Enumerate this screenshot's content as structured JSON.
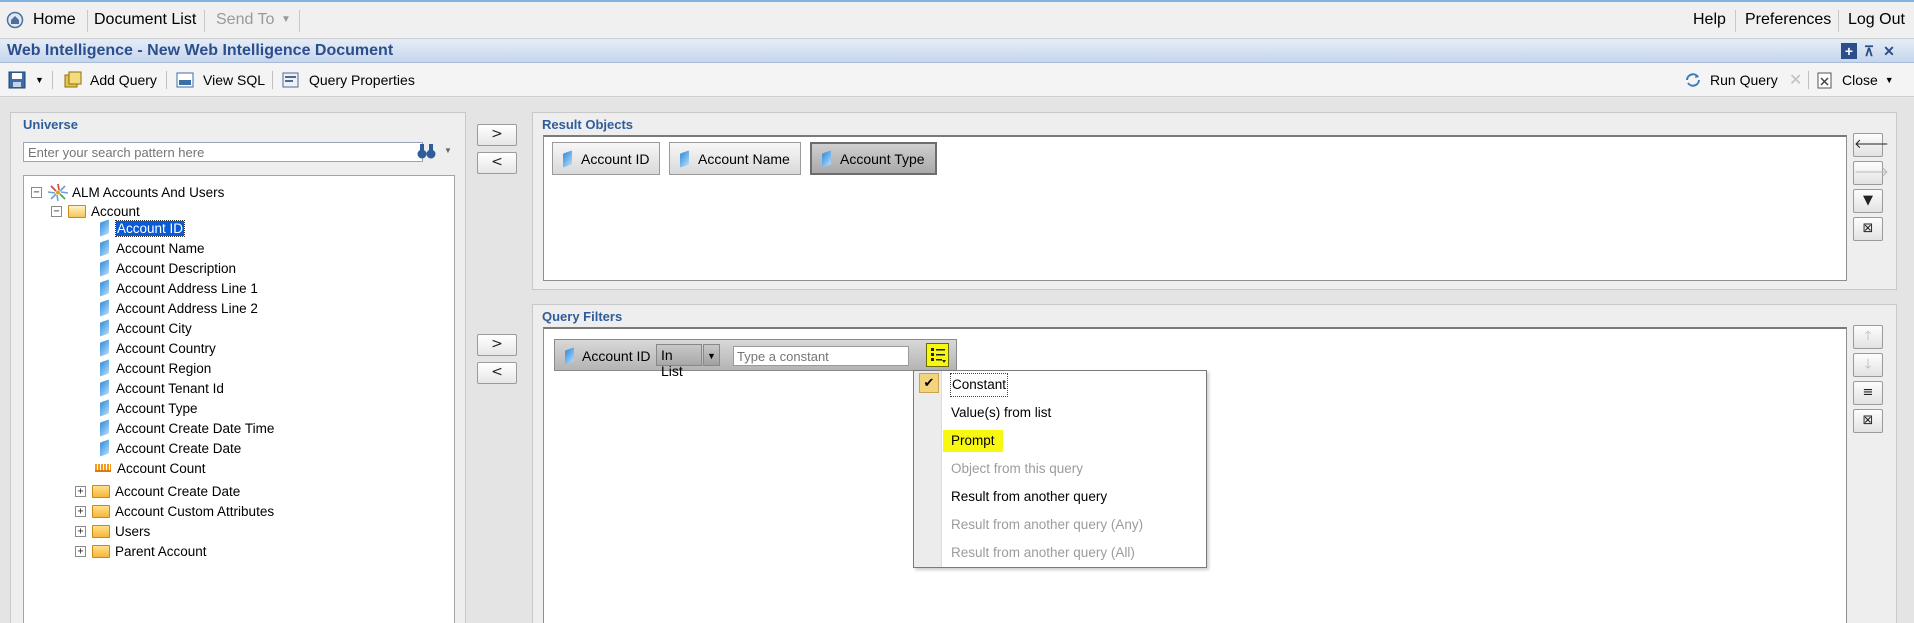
{
  "topnav": {
    "home": "Home",
    "document_list": "Document List",
    "send_to": "Send To",
    "help": "Help",
    "preferences": "Preferences",
    "logout": "Log Out"
  },
  "window": {
    "title": "Web Intelligence - New Web Intelligence Document"
  },
  "toolbar": {
    "add_query": "Add Query",
    "view_sql": "View SQL",
    "query_properties": "Query Properties",
    "run_query": "Run Query",
    "close": "Close"
  },
  "universe": {
    "title": "Universe",
    "search_placeholder": "Enter your search pattern here",
    "root": "ALM Accounts And Users",
    "folder": "Account",
    "objects": [
      "Account ID",
      "Account Name",
      "Account Description",
      "Account Address Line 1",
      "Account Address Line 2",
      "Account City",
      "Account Country",
      "Account Region",
      "Account Tenant Id",
      "Account Type",
      "Account Create Date Time",
      "Account Create Date"
    ],
    "measure": "Account Count",
    "subfolders": [
      "Account Create Date",
      "Account Custom Attributes",
      "Users",
      "Parent Account"
    ]
  },
  "result_objects": {
    "title": "Result Objects",
    "items": [
      "Account ID",
      "Account Name",
      "Account Type"
    ]
  },
  "query_filters": {
    "title": "Query Filters",
    "filter": {
      "object": "Account ID",
      "operator": "In List",
      "value_placeholder": "Type a constant"
    },
    "menu": [
      {
        "label": "Constant",
        "checked": true,
        "disabled": false
      },
      {
        "label": "Value(s) from list",
        "checked": false,
        "disabled": false
      },
      {
        "label": "Prompt",
        "checked": false,
        "disabled": false,
        "highlighted": true
      },
      {
        "label": "Object from this query",
        "checked": false,
        "disabled": true
      },
      {
        "label": "Result from another query",
        "checked": false,
        "disabled": false
      },
      {
        "label": "Result from another query (Any)",
        "checked": false,
        "disabled": true
      },
      {
        "label": "Result from another query (All)",
        "checked": false,
        "disabled": true
      }
    ]
  },
  "colors": {
    "accent": "#2f5d9c",
    "selection": "#0a5ad6",
    "highlight": "#f7f712"
  }
}
